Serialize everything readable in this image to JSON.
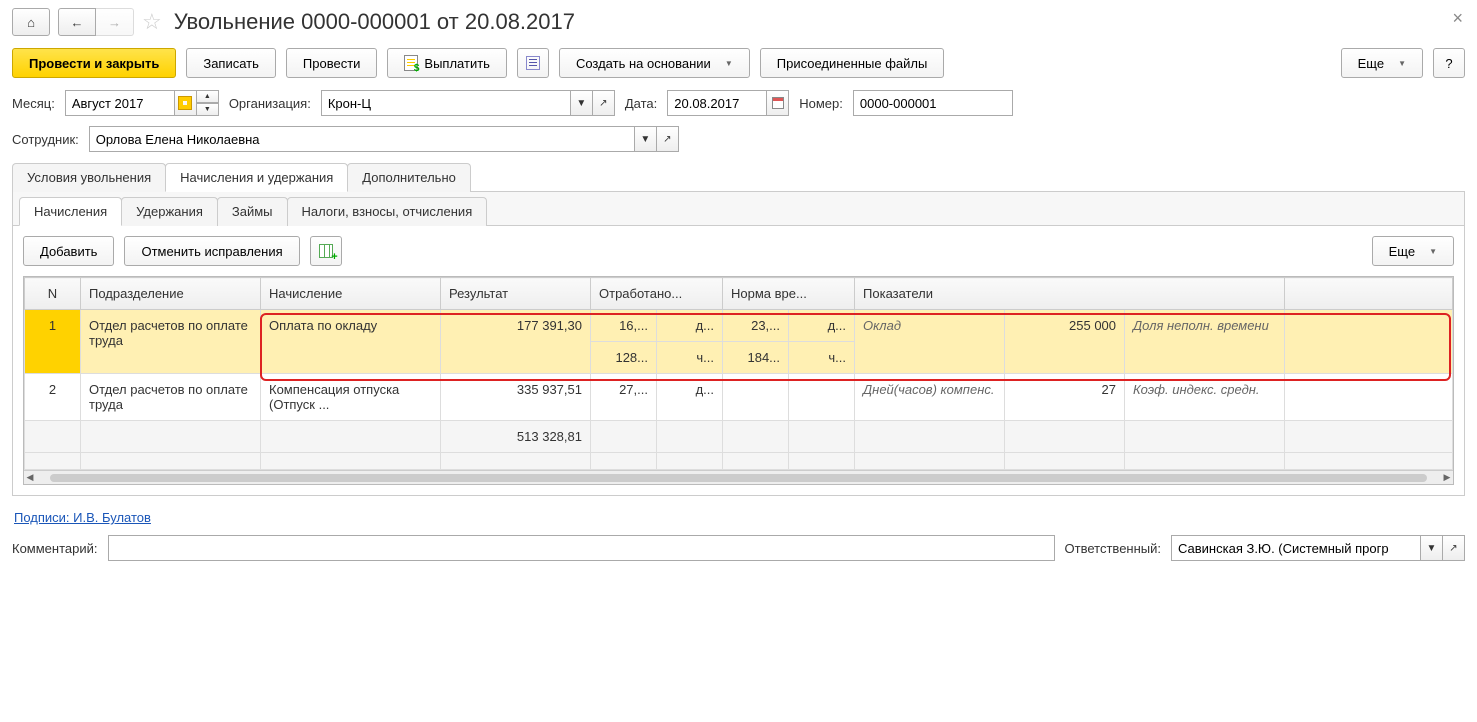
{
  "title": "Увольнение 0000-000001 от 20.08.2017",
  "toolbar": {
    "post_close": "Провести и закрыть",
    "write": "Записать",
    "post": "Провести",
    "pay": "Выплатить",
    "create_based": "Создать на основании",
    "attached": "Присоединенные файлы",
    "more": "Еще",
    "help": "?"
  },
  "form": {
    "month_lbl": "Месяц:",
    "month_val": "Август 2017",
    "org_lbl": "Организация:",
    "org_val": "Крон-Ц",
    "date_lbl": "Дата:",
    "date_val": "20.08.2017",
    "num_lbl": "Номер:",
    "num_val": "0000-000001",
    "emp_lbl": "Сотрудник:",
    "emp_val": "Орлова Елена Николаевна"
  },
  "main_tabs": {
    "t1": "Условия увольнения",
    "t2": "Начисления и удержания",
    "t3": "Дополнительно"
  },
  "sub_tabs": {
    "s1": "Начисления",
    "s2": "Удержания",
    "s3": "Займы",
    "s4": "Налоги, взносы, отчисления"
  },
  "sub_toolbar": {
    "add": "Добавить",
    "undo": "Отменить исправления",
    "more": "Еще"
  },
  "grid": {
    "headers": {
      "n": "N",
      "dept": "Подразделение",
      "accrual": "Начисление",
      "result": "Результат",
      "worked": "Отработано...",
      "normal": "Норма вре...",
      "indicators": "Показатели"
    },
    "rows": [
      {
        "n": "1",
        "dept": "Отдел расчетов по оплате труда",
        "accrual": "Оплата по окладу",
        "result": "177 391,30",
        "w1": "16,...",
        "w1u": "д...",
        "w2": "128...",
        "w2u": "ч...",
        "n1": "23,...",
        "n1u": "д...",
        "n2": "184...",
        "n2u": "ч...",
        "ind_lbl": "Оклад",
        "ind_val": "255 000",
        "ind2_lbl": "Доля неполн. времени"
      },
      {
        "n": "2",
        "dept": "Отдел расчетов по оплате труда",
        "accrual": "Компенсация отпуска (Отпуск ...",
        "result": "335 937,51",
        "w1": "27,...",
        "w1u": "д...",
        "ind_lbl": "Дней(часов) компенс.",
        "ind_val": "27",
        "ind2_lbl": "Коэф. индекс. средн."
      }
    ],
    "total": "513 328,81"
  },
  "signatures": "Подписи: И.В. Булатов",
  "bottom": {
    "comment_lbl": "Комментарий:",
    "resp_lbl": "Ответственный:",
    "resp_val": "Савинская З.Ю. (Системный прогр"
  }
}
